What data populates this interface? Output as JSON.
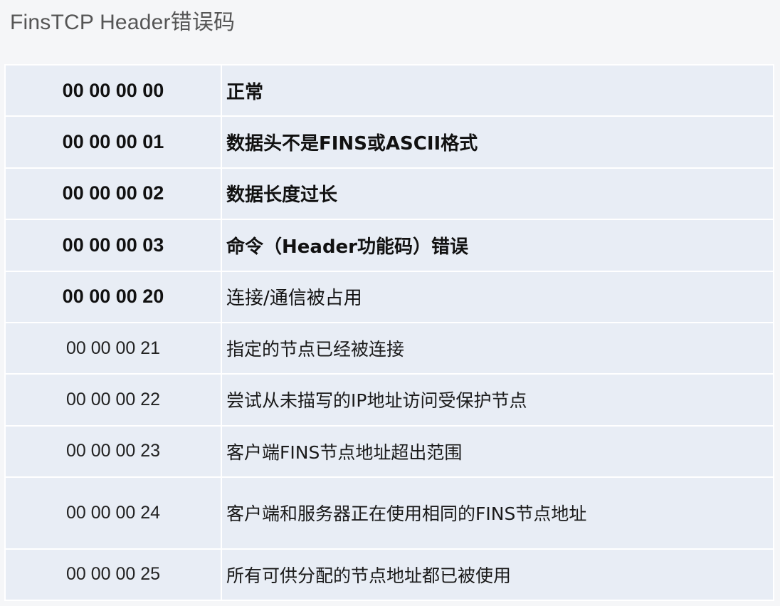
{
  "title": "FinsTCP  Header错误码",
  "rows": [
    {
      "code": "00 00 00 00",
      "desc": "正常"
    },
    {
      "code": "00 00 00 01",
      "desc": "数据头不是FINS或ASCII格式"
    },
    {
      "code": "00 00 00 02",
      "desc": "数据长度过长"
    },
    {
      "code": "00 00 00 03",
      "desc": "命令（Header功能码）错误"
    },
    {
      "code": "00 00 00 20",
      "desc": "连接/通信被占用"
    },
    {
      "code": "00 00 00 21",
      "desc": "指定的节点已经被连接"
    },
    {
      "code": "00 00 00 22",
      "desc": "尝试从未描写的IP地址访问受保护节点"
    },
    {
      "code": "00 00 00 23",
      "desc": "客户端FINS节点地址超出范围"
    },
    {
      "code": "00 00 00 24",
      "desc": "客户端和服务器正在使用相同的FINS节点地址"
    },
    {
      "code": "00 00 00 25",
      "desc": "所有可供分配的节点地址都已被使用"
    }
  ]
}
